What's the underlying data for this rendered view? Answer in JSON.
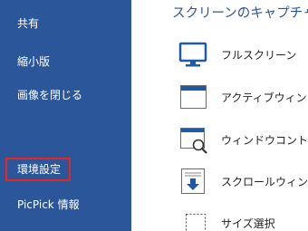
{
  "sidebar": {
    "items": [
      {
        "label": "共有"
      },
      {
        "label": "縮小版"
      },
      {
        "label": "画像を閉じる"
      },
      {
        "label": "環境設定"
      },
      {
        "label": "PicPick 情報"
      }
    ]
  },
  "main": {
    "title": "スクリーンのキャプチャー",
    "options": [
      {
        "label": "フルスクリーン",
        "icon": "monitor-icon"
      },
      {
        "label": "アクティブウィンドウ",
        "icon": "window-icon"
      },
      {
        "label": "ウィンドウコントロール",
        "icon": "window-control-icon"
      },
      {
        "label": "スクロールウィンドウ",
        "icon": "scroll-window-icon"
      },
      {
        "label": "サイズ選択",
        "icon": "region-select-icon"
      }
    ]
  },
  "colors": {
    "sidebar_bg": "#2b579a",
    "accent": "#2b579a",
    "highlight_border": "#e8251f"
  }
}
